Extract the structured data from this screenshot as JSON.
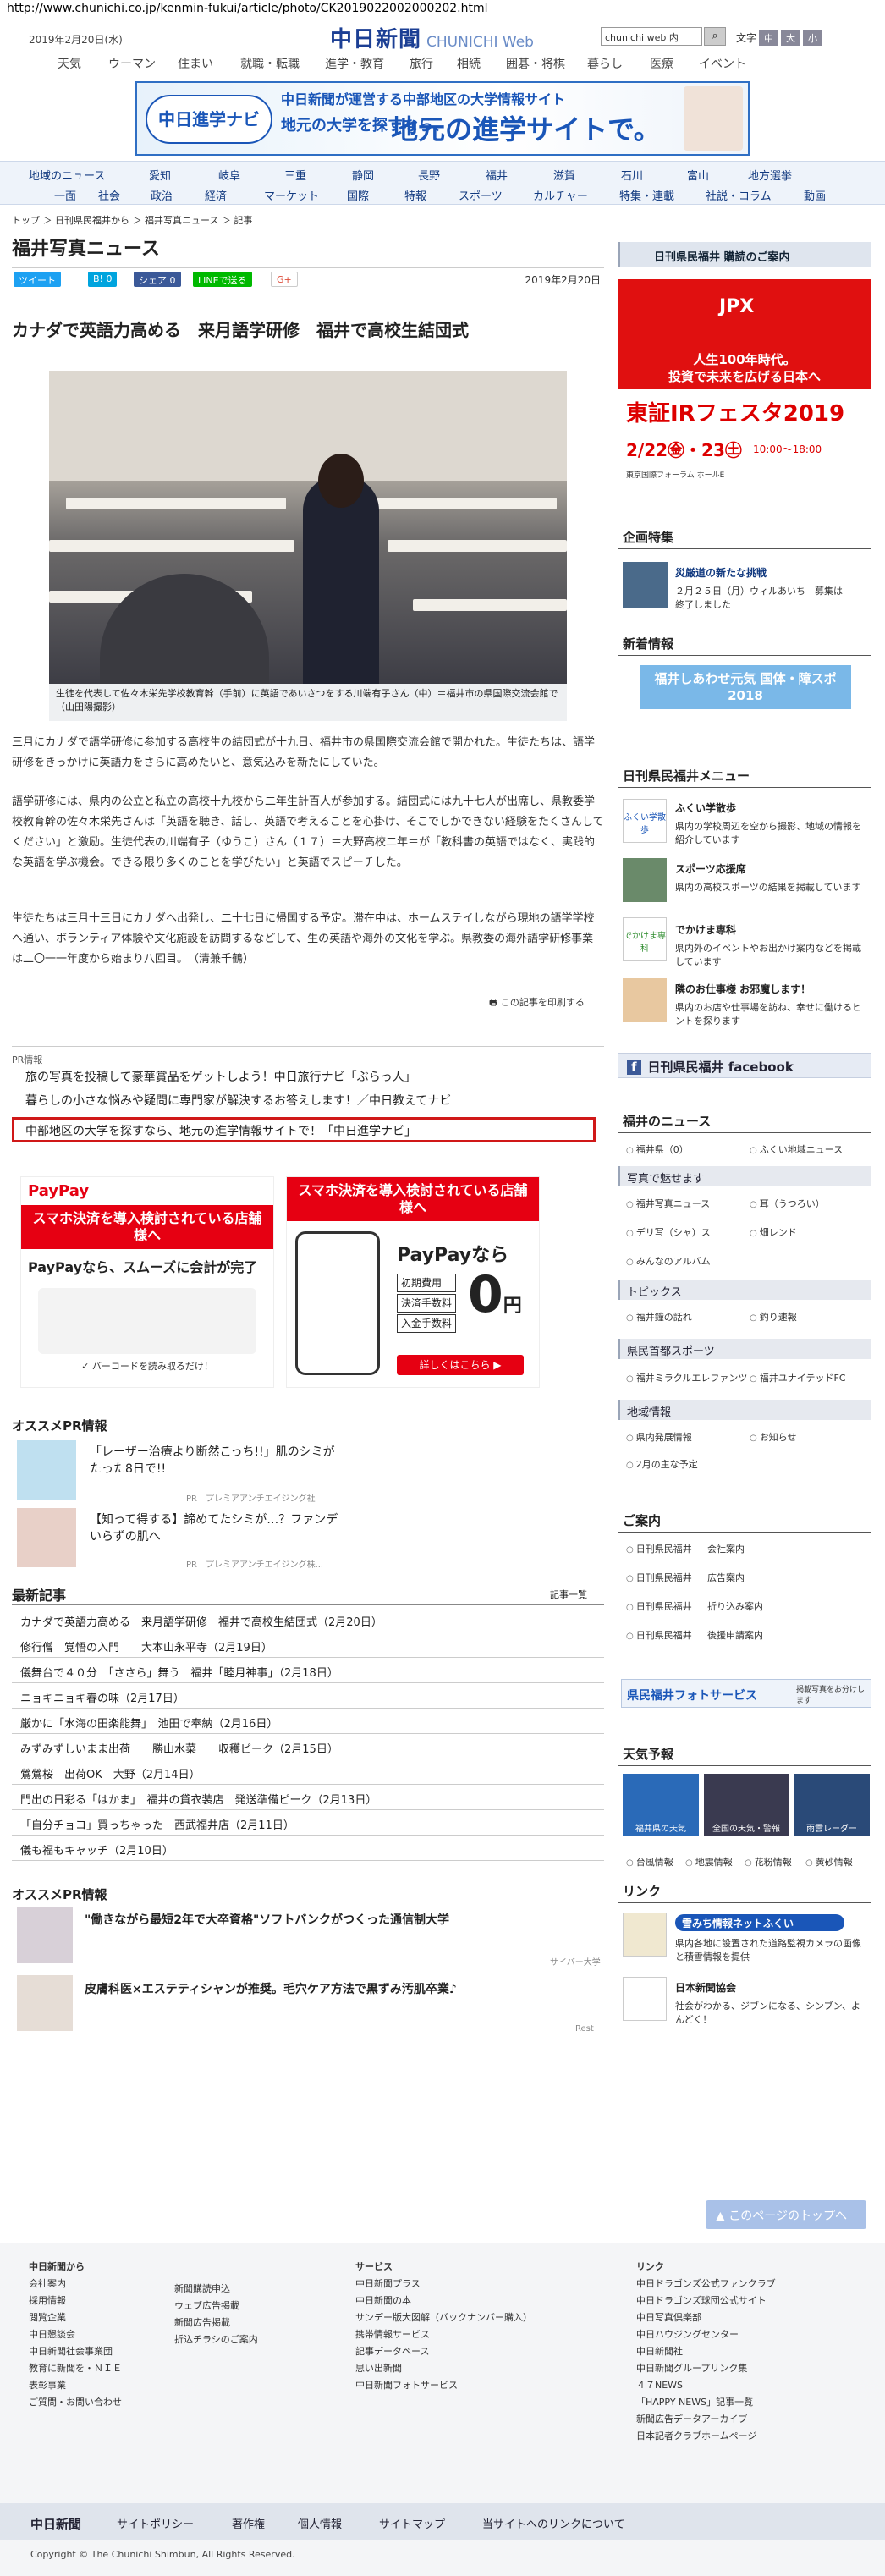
{
  "url": "http://www.chunichi.co.jp/kenmin-fukui/article/photo/CK2019022002000202.html",
  "header": {
    "date": "2019年2月20日(水)",
    "logo": "中日新聞",
    "logo_sub": "CHUNICHI Web",
    "search_value": "chunichi web 内",
    "font_label": "文字",
    "font_medium": "中",
    "font_large": "大",
    "font_small": "小"
  },
  "gnav": [
    "天気",
    "ウーマン",
    "住まい",
    "就職・転職",
    "進学・教育",
    "旅行",
    "相続",
    "囲碁・将棋",
    "暮らし",
    "医療",
    "イベント"
  ],
  "banner": {
    "logo": "中日進学ナビ",
    "line1": "中日新聞が運営する中部地区の大学情報サイト",
    "line2": "地元の大学を探すなら、",
    "line3": "地元の進学サイトで。"
  },
  "lnav_row1": [
    "地域のニュース",
    "愛知",
    "岐阜",
    "三重",
    "静岡",
    "長野",
    "福井",
    "滋賀",
    "石川",
    "富山",
    "地方選挙"
  ],
  "lnav_row2": [
    "一面",
    "社会",
    "政治",
    "経済",
    "マーケット",
    "国際",
    "特報",
    "スポーツ",
    "カルチャー",
    "特集・連載",
    "社説・コラム",
    "動画"
  ],
  "breadcrumb": "トップ ＞ 日刊県民福井から ＞ 福井写真ニュース ＞ 記事",
  "page_title": "福井写真ニュース",
  "share": {
    "tweet": "ツイート",
    "hatena": "B! 0",
    "fb": "シェア 0",
    "line": "LINEで送る",
    "gplus": "G+",
    "date": "2019年2月20日"
  },
  "article": {
    "headline": "カナダで英語力高める　来月語学研修　福井で高校生結団式",
    "caption": "生徒を代表して佐々木栄先学校教育幹（手前）に英語であいさつをする川端有子さん（中）＝福井市の県国際交流会館で（山田陽撮影）",
    "p1": "三月にカナダで語学研修に参加する高校生の結団式が十九日、福井市の県国際交流会館で開かれた。生徒たちは、語学研修をきっかけに英語力をさらに高めたいと、意気込みを新たにしていた。",
    "p2": "語学研修には、県内の公立と私立の高校十九校から二年生計百人が参加する。結団式には九十七人が出席し、県教委学校教育幹の佐々木栄先さんは「英語を聴き、話し、英語で考えることを心掛け、そこでしかできない経験をたくさんしてください」と激励。生徒代表の川端有子（ゆうこ）さん（１７）＝大野高校二年＝が「教科書の英語ではなく、実践的な英語を学ぶ機会。できる限り多くのことを学びたい」と英語でスピーチした。",
    "p3": "生徒たちは三月十三日にカナダへ出発し、二十七日に帰国する予定。滞在中は、ホームステイしながら現地の語学学校へ通い、ボランティア体験や文化施設を訪問するなどして、生の英語や海外の文化を学ぶ。県教委の海外語学研修事業は二〇一一年度から始まり八回目。　（清兼千鶴）",
    "print": "この記事を印刷する"
  },
  "pr": {
    "label": "PR情報",
    "items": [
      "旅の写真を投稿して豪華賞品をゲットしよう！中日旅行ナビ「ぶらっ人」",
      "暮らしの小さな悩みや疑問に専門家が解決するお答えします！／中日教えてナビ",
      "中部地区の大学を探すなら、地元の進学情報サイトで！「中日進学ナビ」"
    ]
  },
  "ads": {
    "paypay": "PayPay",
    "ad1_red": "スマホ決済を導入検討されている店舗様へ",
    "ad1_text": "PayPayなら、スムーズに会計が完了",
    "ad1_foot": "✓ バーコードを読み取るだけ！",
    "ad2_red": "スマホ決済を導入検討されている店舗様へ",
    "ad2_text": "PayPayなら",
    "ad2_fees": [
      "初期費用",
      "決済手数料",
      "入金手数料"
    ],
    "ad2_zero": "0",
    "ad2_yen": "円",
    "ad2_btn": "詳しくはこちら ▶"
  },
  "osusume1": {
    "title": "オススメPR情報",
    "items": [
      {
        "text": "「レーザー治療より断然こっち!!」肌のシミがたった8日で!!",
        "src": "PR　プレミアアンチエイジング社"
      },
      {
        "text": "【知って得する】諦めてたシミが…？ファンデいらずの肌へ",
        "src": "PR　プレミアアンチエイジング株..."
      }
    ]
  },
  "recent": {
    "title": "最新記事",
    "list_link": "記事一覧",
    "items": [
      "カナダで英語力高める　来月語学研修　福井で高校生結団式（2月20日）",
      "修行僧　覚悟の入門　　大本山永平寺（2月19日）",
      "儀舞台で４０分　「ささら」舞う　福井「睦月神事」（2月18日）",
      "ニョキニョキ春の味（2月17日）",
      "厳かに「水海の田楽能舞」　池田で奉納（2月16日）",
      "みずみずしいまま出荷　　勝山水菜　　収穫ピーク（2月15日）",
      "鶯鶯桜　出荷OK　大野（2月14日）",
      "門出の日彩る「はかま」　福井の貸衣装店　発送準備ピーク（2月13日）",
      "「自分チョコ」買っちゃった　西武福井店（2月11日）",
      "儀も福もキャッチ（2月10日）"
    ]
  },
  "osusume2": {
    "title": "オススメPR情報",
    "items": [
      {
        "text": "\"働きながら最短2年で大卒資格\"ソフトバンクがつくった通信制大学",
        "src": "サイバー大学"
      },
      {
        "text": "皮膚科医×エステティシャンが推奨。毛穴ケア方法で黒ずみ汚肌卒業♪",
        "src": "Rest"
      }
    ]
  },
  "sidebar": {
    "subscribe": "日刊県民福井 購読のご案内",
    "jpx": {
      "brand": "JPX",
      "copy1": "人生100年時代。",
      "copy2": "投資で未来を広げる日本へ",
      "title": "東証IRフェスタ2019",
      "dates": "2/22㊎・23㊏",
      "time": "10:00〜18:00",
      "venue": "東京国際フォーラム ホールE"
    },
    "kikaku": {
      "title": "企画特集",
      "item_title": "災厳道の新たな挑戦",
      "item_text": "２月２５日（月）ウィルあいち　募集は終了しました"
    },
    "shinchaku": {
      "title": "新着情報",
      "banner": "福井しあわせ元気 国体・障スポ 2018"
    },
    "menu": {
      "title": "日刊県民福井メニュー",
      "items": [
        {
          "label": "ふくい学散歩",
          "desc": "県内の学校周辺を空から撮影、地域の情報を紹介しています",
          "icon": "ふくい学散歩"
        },
        {
          "label": "スポーツ応援席",
          "desc": "県内の高校スポーツの結果を掲載しています",
          "icon": ""
        },
        {
          "label": "でかけま専科",
          "desc": "県内外のイベントやお出かけ案内などを掲載しています",
          "icon": "でかけま専科"
        },
        {
          "label": "隣のお仕事様 お邪魔します！",
          "desc": "県内のお店や仕事場を訪ね、幸せに働けるヒントを探ります",
          "icon": ""
        }
      ]
    },
    "facebook": "日刊県民福井 facebook",
    "news": {
      "title": "福井のニュース",
      "row1": [
        "福井県（0）",
        "ふくい地域ニュース"
      ],
      "photo_head": "写真で魅せます",
      "row2": [
        "福井写真ニュース",
        "耳（うつろい）"
      ],
      "row3": [
        "デリ写（シャ）ス",
        "畑レンド"
      ],
      "row4": [
        "みんなのアルバム"
      ],
      "topics_head": "トピックス",
      "row5": [
        "福井鐘の話れ",
        "釣り速報"
      ],
      "sports_head": "県民首都スポーツ",
      "row6": [
        "福井ミラクルエレファンツ",
        "福井ユナイテッドFC"
      ],
      "chiiki_head": "地域情報",
      "row7": [
        "県内発展情報",
        "お知らせ"
      ],
      "row8": [
        "2月の主な予定"
      ]
    },
    "annai": {
      "title": "ご案内",
      "rows": [
        [
          "日刊県民福井",
          "会社案内"
        ],
        [
          "日刊県民福井",
          "広告案内"
        ],
        [
          "日刊県民福井",
          "折り込み案内"
        ],
        [
          "日刊県民福井",
          "後援申請案内"
        ]
      ]
    },
    "photoservice": {
      "label": "県民福井フォトサービス",
      "note": "掲載写真をお分けします"
    },
    "weather": {
      "title": "天気予報",
      "tiles": [
        "福井県の天気",
        "全国の天気・警報",
        "雨雲レーダー"
      ],
      "links": [
        "台風情報",
        "地震情報",
        "花粉情報",
        "黄砂情報"
      ]
    },
    "link": {
      "title": "リンク",
      "items": [
        {
          "name": "雪みち情報ネットふくい",
          "desc": "県内各地に設置された道路監視カメラの画像と積雪情報を提供"
        },
        {
          "name": "日本新聞協会",
          "desc": "社会がわかる、ジブンになる、シンブン、よんどく！"
        }
      ]
    }
  },
  "totop": "このページのトップへ",
  "footer": {
    "col1_title": "中日新聞から",
    "col1": [
      "会社案内",
      "採用情報",
      "閲覧企業",
      "中日懇談会",
      "中日新聞社会事業団",
      "教育に新聞を・ＮＩＥ",
      "表彰事業",
      "ご質問・お問い合わせ"
    ],
    "col2": [
      "新聞購読申込",
      "ウェブ広告掲載",
      "新聞広告掲載",
      "折込チラシのご案内"
    ],
    "col3_title": "サービス",
    "col3": [
      "中日新聞プラス",
      "中日新聞の本",
      "サンデー版大図解（バックナンバー購入）",
      "携帯情報サービス",
      "記事データベース",
      "思い出新聞",
      "中日新聞フォトサービス"
    ],
    "col4_title": "リンク",
    "col4": [
      "中日ドラゴンズ公式ファンクラブ",
      "中日ドラゴンズ球団公式サイト",
      "中日写真倶楽部",
      "中日ハウジングセンター",
      "中日新聞社",
      "中日新聞グループリンク集",
      "４７NEWS",
      "「HAPPY NEWS」記事一覧",
      "新聞広告データアーカイブ",
      "日本記者クラブホームページ"
    ],
    "bar": [
      "中日新聞",
      "サイトポリシー",
      "著作権",
      "個人情報",
      "サイトマップ",
      "当サイトへのリンクについて"
    ],
    "copyright": "Copyright © The Chunichi Shimbun, All Rights Reserved."
  }
}
